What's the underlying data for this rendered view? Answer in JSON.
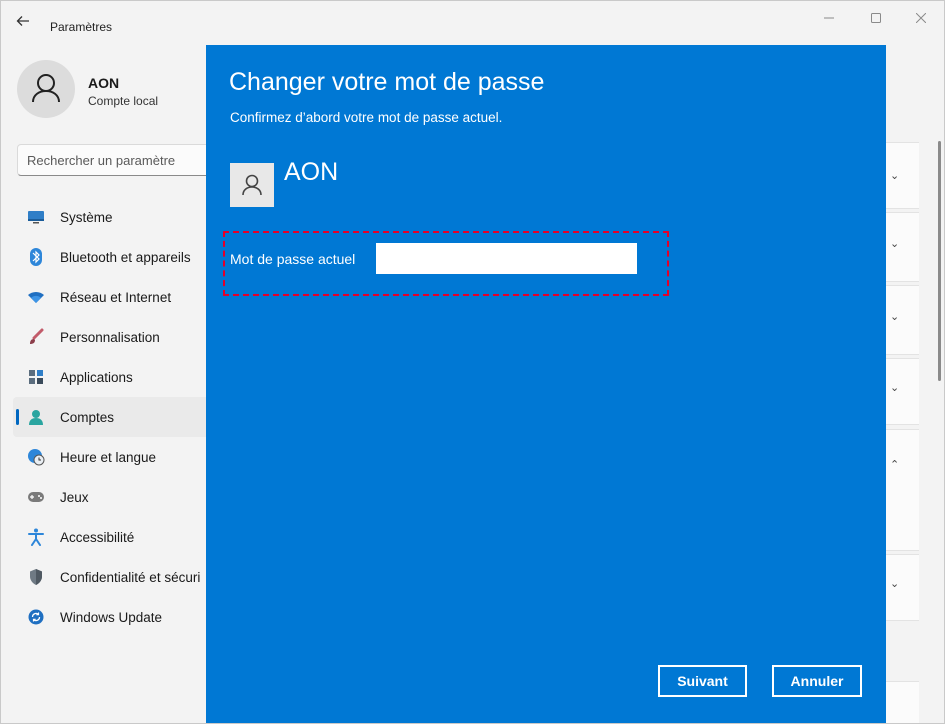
{
  "window": {
    "title": "Paramètres"
  },
  "profile": {
    "name": "AON",
    "account_type": "Compte local"
  },
  "search": {
    "placeholder": "Rechercher un paramètre"
  },
  "sidebar": {
    "items": [
      {
        "label": "Système",
        "icon": "monitor-icon"
      },
      {
        "label": "Bluetooth et appareils",
        "icon": "bluetooth-icon"
      },
      {
        "label": "Réseau et Internet",
        "icon": "wifi-icon"
      },
      {
        "label": "Personnalisation",
        "icon": "brush-icon"
      },
      {
        "label": "Applications",
        "icon": "apps-icon"
      },
      {
        "label": "Comptes",
        "icon": "person-icon",
        "active": true
      },
      {
        "label": "Heure et langue",
        "icon": "globe-clock-icon"
      },
      {
        "label": "Jeux",
        "icon": "gamepad-icon"
      },
      {
        "label": "Accessibilité",
        "icon": "accessibility-icon"
      },
      {
        "label": "Confidentialité et sécuri",
        "icon": "shield-icon"
      },
      {
        "label": "Windows Update",
        "icon": "update-icon"
      }
    ]
  },
  "dialog": {
    "title": "Changer votre mot de passe",
    "subtitle": "Confirmez d’abord votre mot de passe actuel.",
    "user_name": "AON",
    "password_label": "Mot de passe actuel",
    "password_value": "",
    "next_label": "Suivant",
    "cancel_label": "Annuler"
  },
  "colors": {
    "dialog_bg": "#0078d4",
    "accent": "#0067c0",
    "highlight_border": "#e4002b"
  }
}
